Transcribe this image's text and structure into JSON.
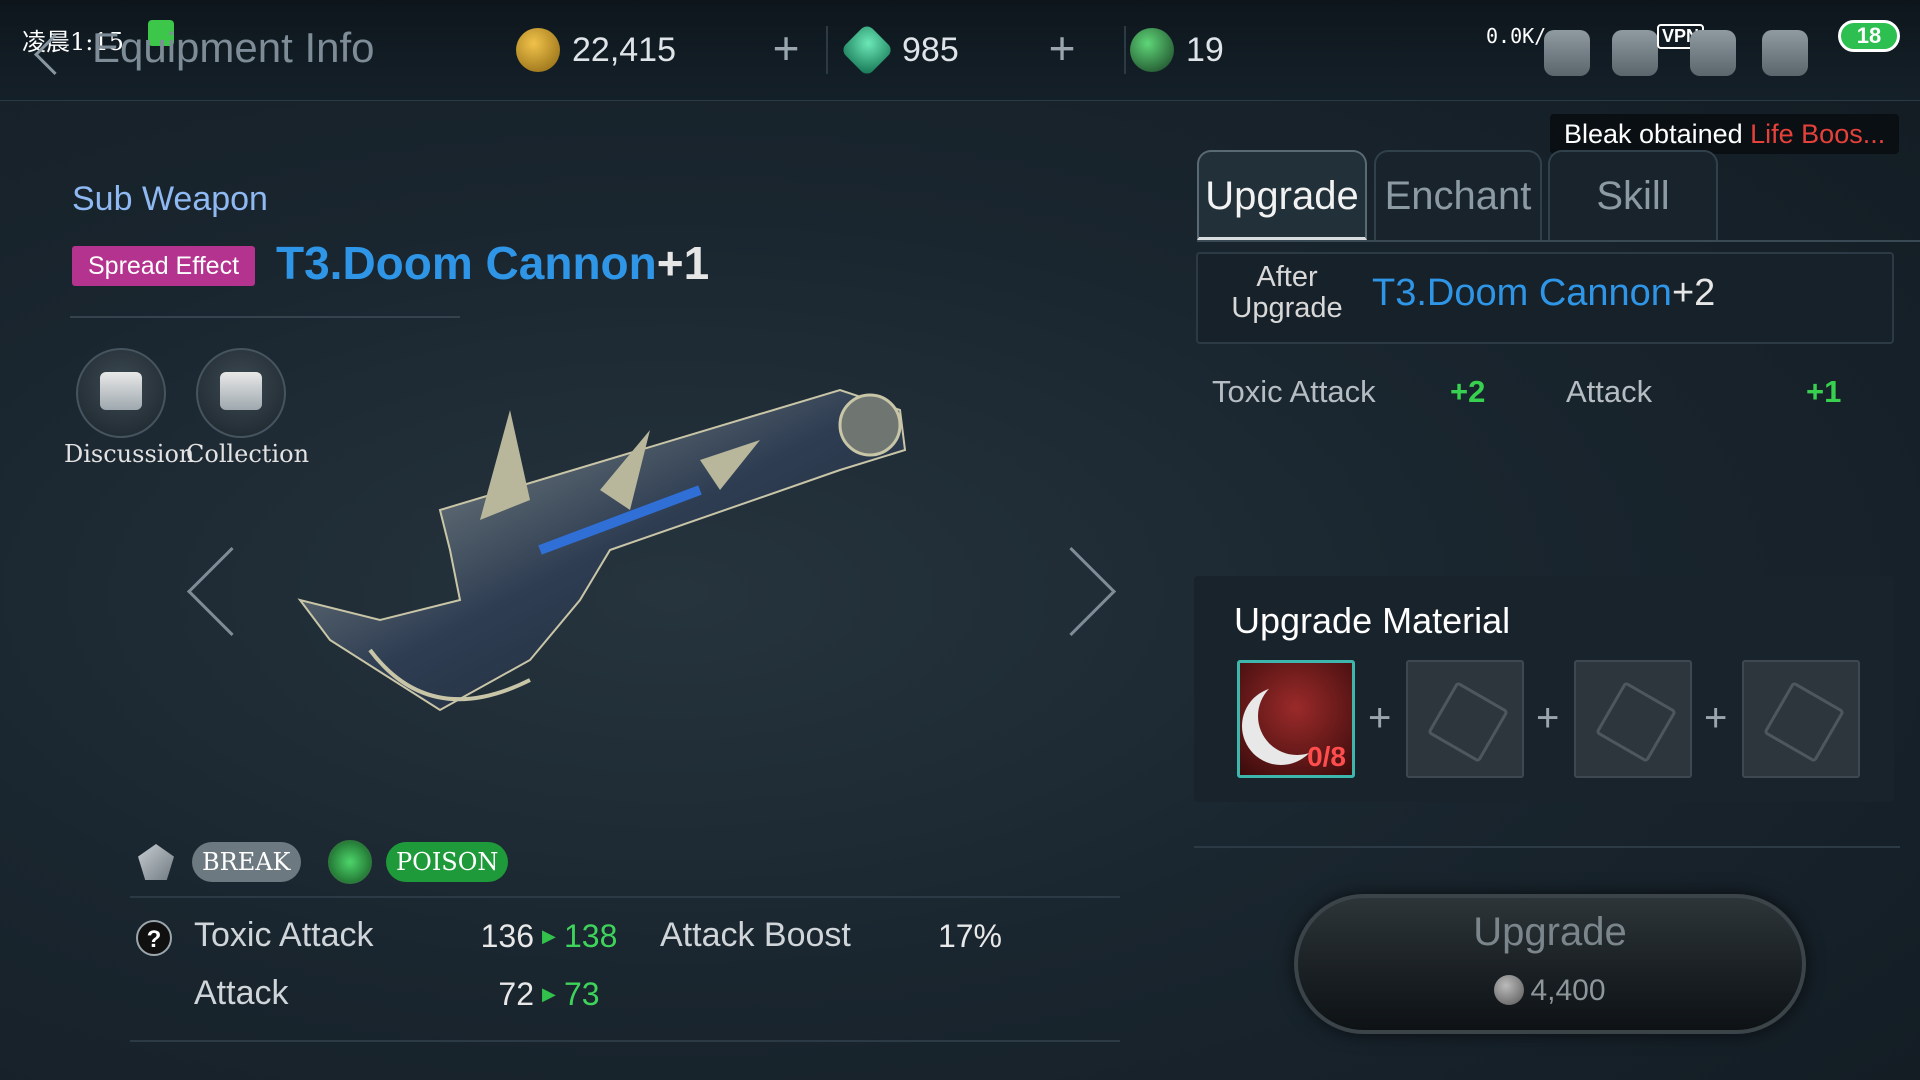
{
  "status_bar": {
    "time": "凌晨1:15",
    "net_speed": "0.0K/s",
    "vpn": "VPN",
    "battery": "18"
  },
  "header": {
    "title": "Equipment Info",
    "gold": "22,415",
    "gems": "985",
    "energy": "19"
  },
  "item": {
    "slot": "Sub Weapon",
    "effect": "Spread Effect",
    "name": "T3.Doom Cannon",
    "level": "+1"
  },
  "actions": {
    "discussion": "Discussion",
    "collection": "Collection"
  },
  "attributes": {
    "break": "BREAK",
    "poison": "POISON"
  },
  "stats": [
    {
      "name": "Toxic Attack",
      "current": "136",
      "next": "138"
    },
    {
      "name": "Attack",
      "current": "72",
      "next": "73"
    }
  ],
  "attack_boost": {
    "label": "Attack Boost",
    "value": "17%"
  },
  "help": "?",
  "toast": {
    "prefix": "Bleak obtained ",
    "highlight": "Life Boos..."
  },
  "tabs": [
    "Upgrade",
    "Enchant",
    "Skill"
  ],
  "after_upgrade": {
    "label": "After Upgrade",
    "name": "T3.Doom Cannon",
    "level": "+2"
  },
  "bonuses": [
    {
      "name": "Toxic Attack",
      "value": "+2"
    },
    {
      "name": "Attack",
      "value": "+1"
    }
  ],
  "materials": {
    "title": "Upgrade Material",
    "count": "0/8",
    "plus": "+"
  },
  "upgrade_button": {
    "label": "Upgrade",
    "cost": "4,400"
  },
  "colors": {
    "accent_blue": "#2f95e6",
    "positive_green": "#37d14f",
    "effect_magenta": "#b3338f",
    "poison_green": "#1f9a3a"
  }
}
